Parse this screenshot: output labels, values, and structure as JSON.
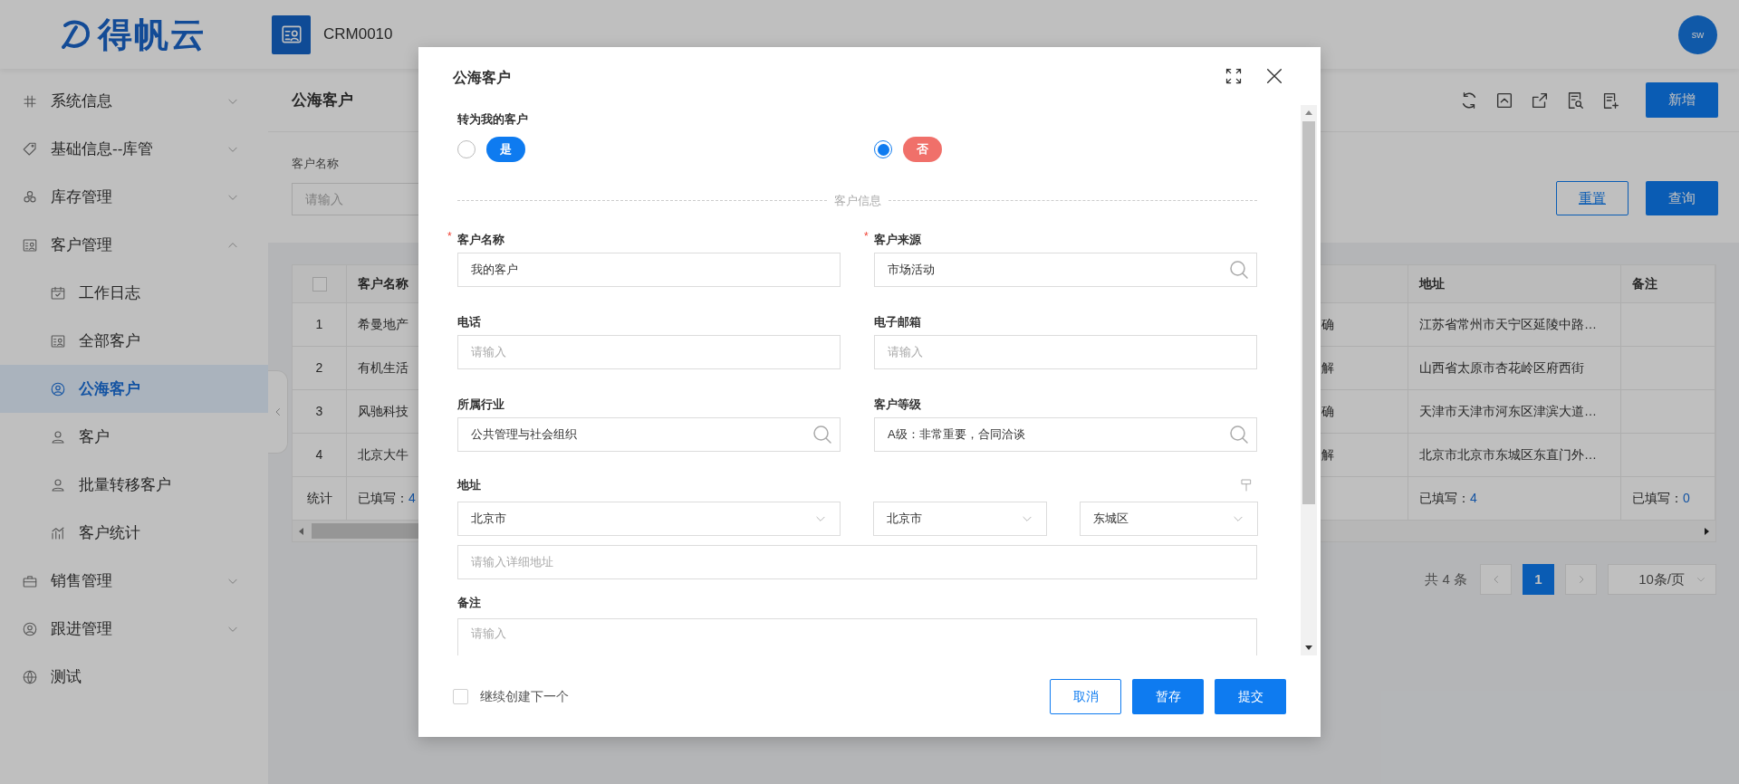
{
  "header": {
    "brand": "得帆云",
    "app_code": "CRM0010",
    "avatar": "sw"
  },
  "sidebar": {
    "items": [
      {
        "label": "系统信息",
        "selected": false,
        "expanded": false
      },
      {
        "label": "基础信息--库管",
        "selected": false,
        "expanded": false
      },
      {
        "label": "库存管理",
        "selected": false,
        "expanded": false
      },
      {
        "label": "客户管理",
        "selected": false,
        "expanded": true,
        "children": [
          {
            "label": "工作日志",
            "selected": false
          },
          {
            "label": "全部客户",
            "selected": false
          },
          {
            "label": "公海客户",
            "selected": true
          },
          {
            "label": "客户",
            "selected": false
          },
          {
            "label": "批量转移客户",
            "selected": false
          },
          {
            "label": "客户统计",
            "selected": false
          }
        ]
      },
      {
        "label": "销售管理",
        "selected": false,
        "expanded": false
      },
      {
        "label": "跟进管理",
        "selected": false,
        "expanded": false
      },
      {
        "label": "测试",
        "selected": false
      }
    ]
  },
  "page": {
    "title": "公海客户",
    "new_button": "新增"
  },
  "filter": {
    "label": "客户名称",
    "placeholder": "请输入",
    "reset_button": "重置",
    "search_button": "查询"
  },
  "table": {
    "header_checkbox": {
      "checked": false
    },
    "columns": {
      "name": "客户名称",
      "address": "地址",
      "remarks": "备注"
    },
    "rows": [
      {
        "index": "1",
        "name": "希曼地产",
        "column_3": "确",
        "address": "江苏省常州市天宁区延陵中路…"
      },
      {
        "index": "2",
        "name": "有机生活",
        "column_3": "解",
        "address": "山西省太原市杏花岭区府西街"
      },
      {
        "index": "3",
        "name": "风驰科技",
        "column_3": "确",
        "address": "天津市天津市河东区津滨大道…"
      },
      {
        "index": "4",
        "name": "北京大牛",
        "column_3": "解",
        "address": "北京市北京市东城区东直门外…"
      }
    ],
    "summary": {
      "label": "统计",
      "name": {
        "prefix": "已填写：",
        "count": "4"
      },
      "address": {
        "prefix": "已填写：",
        "count": "4"
      },
      "remarks": {
        "prefix": "已填写：",
        "count": "0"
      }
    }
  },
  "pagination": {
    "total": "共 4 条",
    "pages": [
      {
        "label": "1",
        "selected": true
      }
    ],
    "page_size": "10条/页"
  },
  "modal": {
    "title": "公海客户",
    "convert": {
      "label": "转为我的客户",
      "options": [
        {
          "label": "是",
          "selected": false,
          "color": "#0e7bf0"
        },
        {
          "label": "否",
          "selected": true,
          "color": "#f0706a"
        }
      ]
    },
    "section": "客户信息",
    "fields": [
      {
        "label": "客户名称",
        "required_mark": "*",
        "kind": "text",
        "value": "我的客户"
      },
      {
        "label": "客户来源",
        "required_mark": "*",
        "kind": "lookup",
        "value": "市场活动"
      },
      {
        "label": "电话",
        "kind": "text",
        "placeholder": "请输入"
      },
      {
        "label": "电子邮箱",
        "kind": "text",
        "placeholder": "请输入"
      },
      {
        "label": "所属行业",
        "kind": "lookup",
        "value": "公共管理与社会组织"
      },
      {
        "label": "客户等级",
        "kind": "lookup",
        "value": "A级：非常重要，合同洽谈"
      }
    ],
    "address": {
      "label": "地址",
      "province": "北京市",
      "city": "北京市",
      "district": "东城区",
      "detail_placeholder": "请输入详细地址"
    },
    "remarks": {
      "label": "备注",
      "placeholder": "请输入"
    },
    "continue": {
      "label": "继续创建下一个",
      "checked": false
    },
    "buttons": [
      {
        "label": "取消",
        "kind": "outline"
      },
      {
        "label": "暂存",
        "kind": "primary"
      },
      {
        "label": "提交",
        "kind": "primary"
      }
    ]
  }
}
